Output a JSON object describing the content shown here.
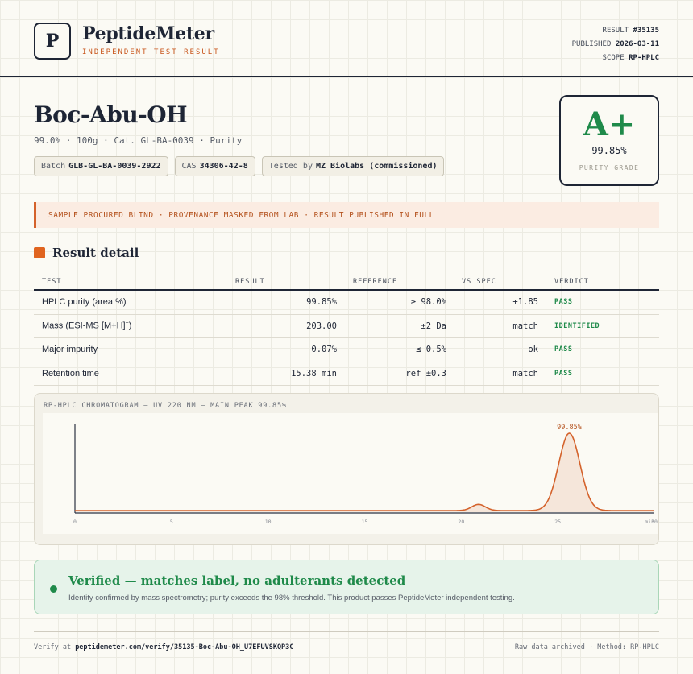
{
  "header": {
    "logo_letter": "P",
    "brand": "PeptideMeter",
    "tagline": "INDEPENDENT TEST RESULT",
    "result_label": "RESULT",
    "result_value": "#35135",
    "published_label": "PUBLISHED",
    "published_value": "2026-03-11",
    "scope_label": "SCOPE",
    "scope_value": "RP-HPLC"
  },
  "product": {
    "title": "Boc-Abu-OH",
    "subtitle": "99.0% · 100g · Cat. GL-BA-0039 · Purity",
    "chips": [
      {
        "label": "Batch",
        "value": "GLB-GL-BA-0039-2922"
      },
      {
        "label": "CAS",
        "value": "34306-42-8"
      },
      {
        "label": "Tested by",
        "value": "MZ Biolabs (commissioned)"
      }
    ]
  },
  "grade": {
    "letter": "A+",
    "value": "99.85%",
    "label": "PURITY GRADE",
    "color": "#1f8a4a"
  },
  "notice": "SAMPLE PROCURED BLIND · PROVENANCE MASKED FROM LAB · RESULT PUBLISHED IN FULL",
  "section_title": "Result detail",
  "table": {
    "headers": [
      "TEST",
      "RESULT",
      "REFERENCE",
      "VS SPEC",
      "VERDICT"
    ],
    "rows": [
      {
        "test": "HPLC purity (area %)",
        "result": "99.85%",
        "reference": "≥ 98.0%",
        "vs_spec": "+1.85",
        "verdict": "PASS"
      },
      {
        "test": "Mass (ESI-MS [M+H]",
        "test_sup": "+",
        "test_end": ")",
        "result": "203.00",
        "reference": "±2 Da",
        "vs_spec": "match",
        "verdict": "IDENTIFIED"
      },
      {
        "test": "Major impurity",
        "result": "0.07%",
        "reference": "≤ 0.5%",
        "vs_spec": "ok",
        "verdict": "PASS"
      },
      {
        "test": "Retention time",
        "result": "15.38 min",
        "reference": "ref ±0.3",
        "vs_spec": "match",
        "verdict": "PASS"
      }
    ]
  },
  "chromatogram": {
    "title": "RP-HPLC CHROMATOGRAM — UV 220 NM — MAIN PEAK 99.85%",
    "peak_label": "99.85%",
    "line_color": "#d4622b",
    "chart_data": {
      "type": "line",
      "x_ticks": [
        "0",
        "5",
        "10",
        "15",
        "20",
        "25",
        "30"
      ],
      "x_end_label": "min",
      "xlim": [
        0,
        30
      ],
      "peaks": [
        {
          "center": 20.9,
          "height": 0.08,
          "width": 0.35
        },
        {
          "center": 25.6,
          "height": 1.0,
          "width": 0.55
        }
      ]
    }
  },
  "verified": {
    "title": "Verified — matches label, no adulterants detected",
    "text": "Identity confirmed by mass spectrometry; purity exceeds the 98% threshold. This product passes PeptideMeter independent testing."
  },
  "footer": {
    "verify_prefix": "Verify at",
    "verify_url": "peptidemeter.com/verify/35135-Boc-Abu-OH_U7EFUVSKQP3C",
    "right": "Raw data archived · Method: RP-HPLC"
  }
}
